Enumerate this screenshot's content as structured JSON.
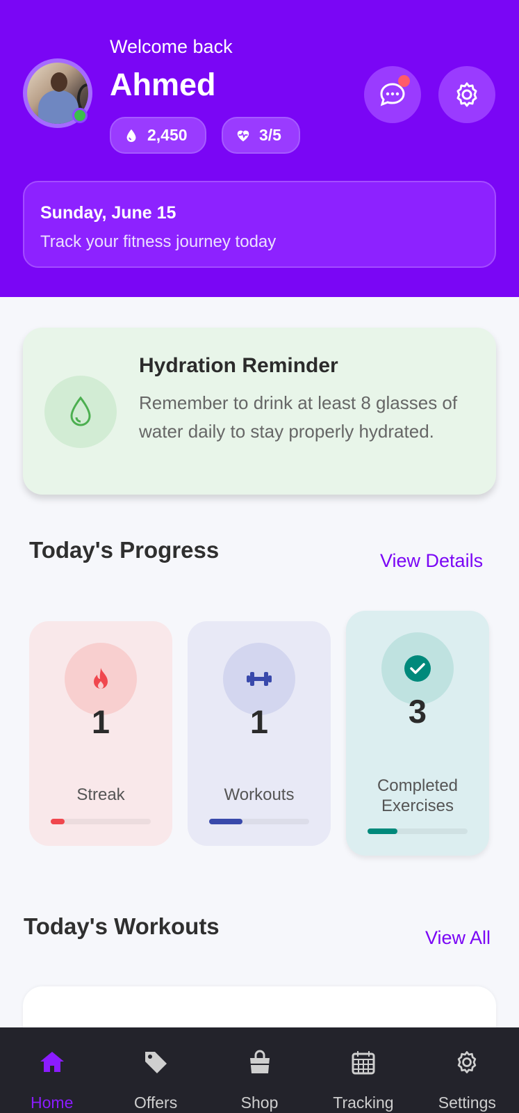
{
  "header": {
    "welcome": "Welcome back",
    "username": "Ahmed",
    "points": "2,450",
    "hearts": "3/5",
    "date": "Sunday, June 15",
    "tagline": "Track your fitness journey today"
  },
  "hydration": {
    "title": "Hydration Reminder",
    "text": "Remember to drink at least 8 glasses of water daily to stay properly hydrated."
  },
  "progress": {
    "title": "Today's Progress",
    "link": "View Details",
    "stats": [
      {
        "value": "1",
        "label": "Streak",
        "fill_fraction": 0.14
      },
      {
        "value": "1",
        "label": "Workouts",
        "fill_fraction": 0.33
      },
      {
        "value": "3",
        "label": "Completed Exercises",
        "fill_fraction": 0.3
      }
    ]
  },
  "workouts": {
    "title": "Today's Workouts",
    "link": "View All"
  },
  "nav": {
    "items": [
      {
        "label": "Home",
        "icon": "home-icon",
        "active": true
      },
      {
        "label": "Offers",
        "icon": "tag-icon",
        "active": false
      },
      {
        "label": "Shop",
        "icon": "shopping-bag-icon",
        "active": false
      },
      {
        "label": "Tracking",
        "icon": "calendar-icon",
        "active": false
      },
      {
        "label": "Settings",
        "icon": "gear-icon",
        "active": false
      }
    ]
  },
  "colors": {
    "primary": "#7a06f5",
    "nav_bg": "#23232b",
    "streak": "#f0474e",
    "workouts": "#3949ab",
    "completed": "#00897b",
    "hydration": "#4caf50"
  }
}
